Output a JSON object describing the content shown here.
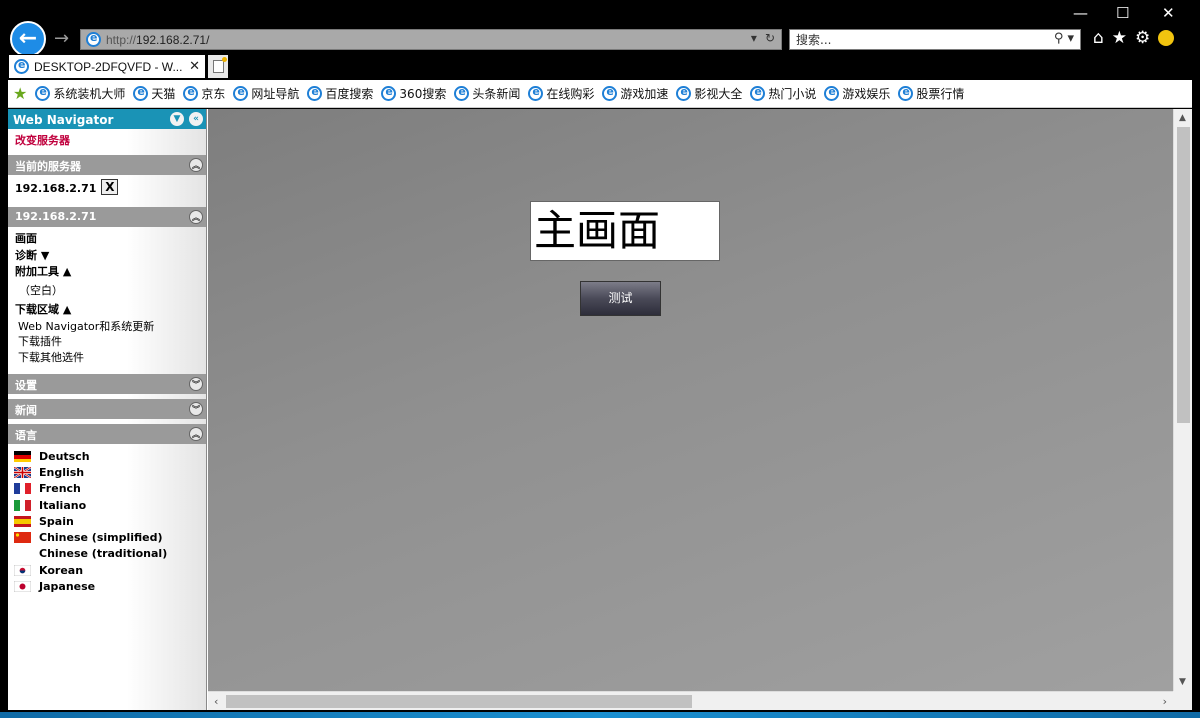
{
  "browser": {
    "url_proto": "http://",
    "url_host": "192.168.2.71/",
    "search_placeholder": "搜索...",
    "tab_title": "DESKTOP-2DFQVFD - W...",
    "favorites": [
      "系统装机大师",
      "天猫",
      "京东",
      "网址导航",
      "百度搜索",
      "360搜索",
      "头条新闻",
      "在线购彩",
      "游戏加速",
      "影视大全",
      "热门小说",
      "游戏娱乐",
      "股票行情"
    ]
  },
  "sidebar": {
    "title": "Web Navigator",
    "change_server": "改变服务器",
    "current_server_header": "当前的服务器",
    "current_server": "192.168.2.71",
    "server_section_header": "192.168.2.71",
    "menu": {
      "screen": "画面",
      "diagnostics": "诊断 ▼",
      "extra_tools": "附加工具 ▲",
      "empty": "（空白）",
      "download_area": "下载区域 ▲",
      "downloads": [
        "Web Navigator和系统更新",
        "下载插件",
        "下载其他选件"
      ]
    },
    "settings_header": "设置",
    "news_header": "新闻",
    "language_header": "语言",
    "languages": [
      {
        "name": "Deutsch",
        "flag": "de"
      },
      {
        "name": "English",
        "flag": "gb"
      },
      {
        "name": "French",
        "flag": "fr"
      },
      {
        "name": "Italiano",
        "flag": "it"
      },
      {
        "name": "Spain",
        "flag": "es"
      },
      {
        "name": "Chinese (simplified)",
        "flag": "cn"
      },
      {
        "name": "Chinese (traditional)",
        "flag": "none"
      },
      {
        "name": "Korean",
        "flag": "kr"
      },
      {
        "name": "Japanese",
        "flag": "jp"
      }
    ]
  },
  "main": {
    "title": "主画面",
    "test_button": "测试"
  }
}
